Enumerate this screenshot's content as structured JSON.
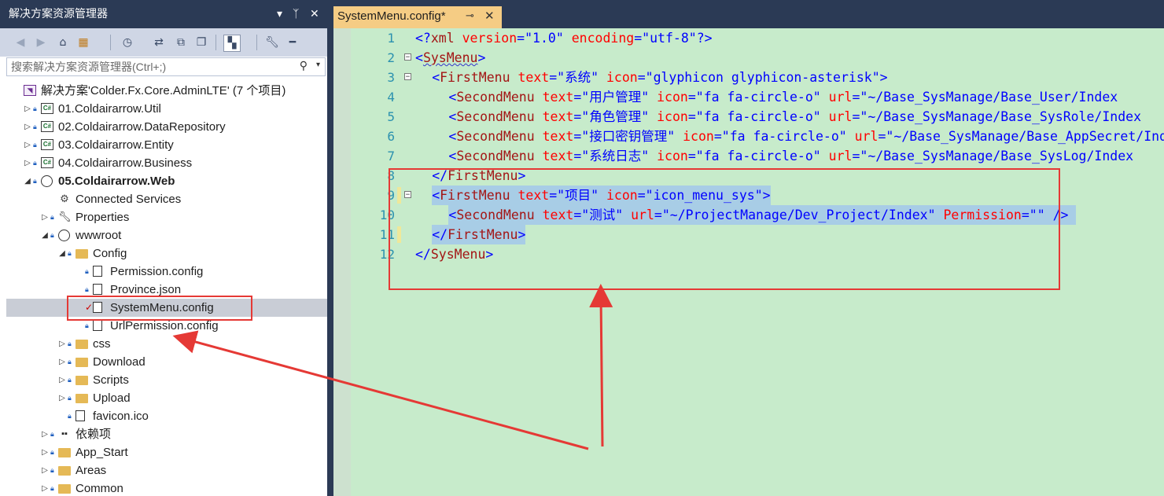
{
  "solution_explorer": {
    "title": "解决方案资源管理器",
    "title_controls": {
      "dropdown": "▾",
      "pin": "ᛉ",
      "close": "✕"
    },
    "search_placeholder": "搜索解决方案资源管理器(Ctrl+;)",
    "tree": [
      {
        "label": "解决方案'Colder.Fx.Core.AdminLTE' (7 个项目)",
        "icon": "solution-icon",
        "depth": 0,
        "expander": ""
      },
      {
        "label": "01.Coldairarrow.Util",
        "icon": "csharp-project-icon",
        "depth": 1,
        "expander": "▷"
      },
      {
        "label": "02.Coldairarrow.DataRepository",
        "icon": "csharp-project-icon",
        "depth": 1,
        "expander": "▷"
      },
      {
        "label": "03.Coldairarrow.Entity",
        "icon": "csharp-project-icon",
        "depth": 1,
        "expander": "▷"
      },
      {
        "label": "04.Coldairarrow.Business",
        "icon": "csharp-project-icon",
        "depth": 1,
        "expander": "▷"
      },
      {
        "label": "05.Coldairarrow.Web",
        "icon": "web-project-icon",
        "depth": 1,
        "expander": "◢",
        "bold": true
      },
      {
        "label": "Connected Services",
        "icon": "connected-services-icon",
        "depth": 2,
        "expander": ""
      },
      {
        "label": "Properties",
        "icon": "wrench-icon",
        "depth": 2,
        "expander": "▷"
      },
      {
        "label": "wwwroot",
        "icon": "globe-icon",
        "depth": 2,
        "expander": "◢"
      },
      {
        "label": "Config",
        "icon": "folder-open-icon",
        "depth": 3,
        "expander": "◢"
      },
      {
        "label": "Permission.config",
        "icon": "config-file-icon",
        "depth": 4,
        "expander": ""
      },
      {
        "label": "Province.json",
        "icon": "json-file-icon",
        "depth": 4,
        "expander": ""
      },
      {
        "label": "SystemMenu.config",
        "icon": "config-file-icon",
        "depth": 4,
        "expander": "",
        "selected": true,
        "modified": true
      },
      {
        "label": "UrlPermission.config",
        "icon": "config-file-icon",
        "depth": 4,
        "expander": ""
      },
      {
        "label": "css",
        "icon": "folder-icon",
        "depth": 3,
        "expander": "▷"
      },
      {
        "label": "Download",
        "icon": "folder-icon",
        "depth": 3,
        "expander": "▷"
      },
      {
        "label": "Scripts",
        "icon": "folder-icon",
        "depth": 3,
        "expander": "▷"
      },
      {
        "label": "Upload",
        "icon": "folder-icon",
        "depth": 3,
        "expander": "▷"
      },
      {
        "label": "favicon.ico",
        "icon": "ico-file-icon",
        "depth": 3,
        "expander": ""
      },
      {
        "label": "依赖项",
        "icon": "dependencies-icon",
        "depth": 2,
        "expander": "▷"
      },
      {
        "label": "App_Start",
        "icon": "folder-icon",
        "depth": 2,
        "expander": "▷"
      },
      {
        "label": "Areas",
        "icon": "folder-icon",
        "depth": 2,
        "expander": "▷"
      },
      {
        "label": "Common",
        "icon": "folder-icon",
        "depth": 2,
        "expander": "▷"
      }
    ]
  },
  "editor": {
    "tab": {
      "label": "SystemMenu.config*",
      "pin": "⊸",
      "close": "✕"
    },
    "lines": [
      {
        "n": "1"
      },
      {
        "n": "2"
      },
      {
        "n": "3"
      },
      {
        "n": "4"
      },
      {
        "n": "5"
      },
      {
        "n": "6"
      },
      {
        "n": "7"
      },
      {
        "n": "8"
      },
      {
        "n": "9"
      },
      {
        "n": "10"
      },
      {
        "n": "11"
      },
      {
        "n": "12"
      }
    ],
    "code": {
      "l1": [
        "<?",
        "xml",
        " version",
        "=\"",
        "1.0",
        "\"",
        " encoding",
        "=\"",
        "utf-8",
        "\"",
        "?>"
      ],
      "l2": [
        "<",
        "SysMenu",
        ">"
      ],
      "l3": [
        "<",
        "FirstMenu",
        " text",
        "=\"",
        "系统",
        "\"",
        " icon",
        "=\"",
        "glyphicon glyphicon-asterisk",
        "\"",
        ">"
      ],
      "l4": [
        "<",
        "SecondMenu",
        " text",
        "=\"",
        "用户管理",
        "\"",
        " icon",
        "=\"",
        "fa fa-circle-o",
        "\"",
        " url",
        "=\"",
        "~/Base_SysManage/Base_User/Index"
      ],
      "l5": [
        "<",
        "SecondMenu",
        " text",
        "=\"",
        "角色管理",
        "\"",
        " icon",
        "=\"",
        "fa fa-circle-o",
        "\"",
        " url",
        "=\"",
        "~/Base_SysManage/Base_SysRole/Index"
      ],
      "l6": [
        "<",
        "SecondMenu",
        " text",
        "=\"",
        "接口密钥管理",
        "\"",
        " icon",
        "=\"",
        "fa fa-circle-o",
        "\"",
        " url",
        "=\"",
        "~/Base_SysManage/Base_AppSecret/Index"
      ],
      "l7": [
        "<",
        "SecondMenu",
        " text",
        "=\"",
        "系统日志",
        "\"",
        " icon",
        "=\"",
        "fa fa-circle-o",
        "\"",
        " url",
        "=\"",
        "~/Base_SysManage/Base_SysLog/Index"
      ],
      "l8": [
        "</",
        "FirstMenu",
        ">"
      ],
      "l9": [
        "<",
        "FirstMenu",
        " text",
        "=\"",
        "项目",
        "\"",
        " icon",
        "=\"",
        "icon_menu_sys",
        "\"",
        ">"
      ],
      "l10": [
        "<",
        "SecondMenu",
        " text",
        "=\"",
        "测试",
        "\"",
        " url",
        "=\"",
        "~/ProjectManage/Dev_Project/Index",
        "\"",
        " Permission",
        "=\"",
        "",
        "\"",
        " />"
      ],
      "l11": [
        "</",
        "FirstMenu",
        ">"
      ],
      "l12": [
        "</",
        "SysMenu",
        ">"
      ]
    }
  },
  "colors": {
    "editor_background": "#c7ebcb",
    "selection_highlight": "#a8cde6",
    "annotation_red": "#e53935",
    "tab_active": "#f5cc84",
    "chrome": "#2b3a55"
  }
}
